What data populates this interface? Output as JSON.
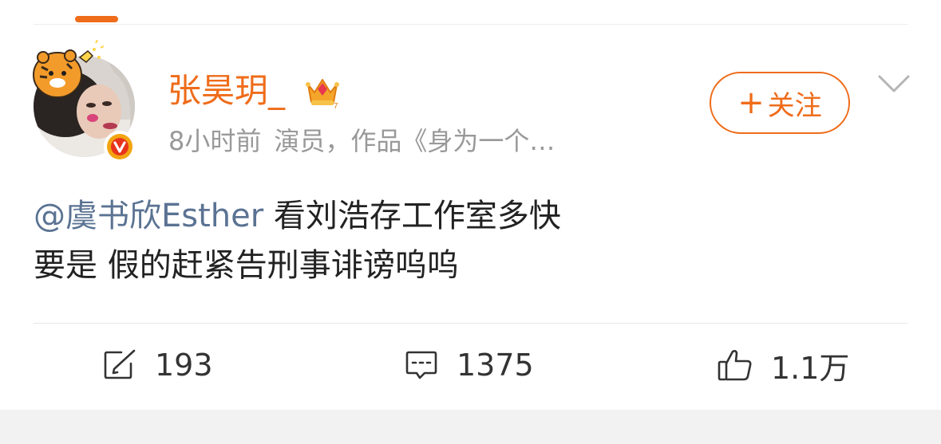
{
  "colors": {
    "accent_orange": "#ef6c1a",
    "mention_blue": "#5b7393",
    "meta_gray": "#999999",
    "badge_orange": "#f2a411",
    "badge_red": "#e8341c"
  },
  "post": {
    "author": {
      "name": "张昊玥_",
      "avatar_icon": "avatar-photo",
      "verified_icon": "verified-v-badge",
      "member_icon": "crown-icon"
    },
    "time": "8小时前",
    "description": "演员，作品《身为一个…",
    "follow_label": "关注",
    "follow_icon": "plus-icon",
    "menu_icon": "chevron-down-icon",
    "content": {
      "mention": "@虞书欣Esther",
      "line1_rest": " 看刘浩存工作室多快",
      "line2": "要是 假的赶紧告刑事诽谤呜呜"
    },
    "actions": {
      "repost_icon": "share-icon",
      "repost_count": "193",
      "comment_icon": "comment-icon",
      "comment_count": "1375",
      "like_icon": "thumbs-up-icon",
      "like_count": "1.1万"
    }
  }
}
